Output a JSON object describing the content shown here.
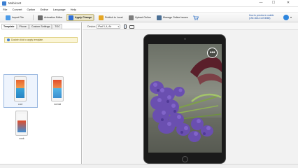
{
  "window": {
    "title": "Mobicont",
    "minimize": "—",
    "maximize": "☐",
    "close": "✕"
  },
  "menu": [
    "File",
    "Convert",
    "Option",
    "Online",
    "Language",
    "Help"
  ],
  "toolbar": {
    "import_label": "Import File",
    "animation_label": "Animation Editor",
    "apply_label": "Apply Change",
    "publish_label": "Publish to Local",
    "upload_label": "Upload Online",
    "manage_label": "Manage Online Issues",
    "preview_note": "How to preview in mobile (192.168.2.147:8080)"
  },
  "tabs": [
    "Template",
    "Phone",
    "Custom Settings",
    "TOC"
  ],
  "left_panel": {
    "info_text": "Double click to apply template.",
    "templates": [
      {
        "label": "cool"
      },
      {
        "label": "normal"
      },
      {
        "label": "cook"
      }
    ]
  },
  "device_bar": {
    "label": "Device:",
    "selected": "iPad 3, 4, Air"
  },
  "preview": {
    "menu_glyph": "●●●"
  },
  "colors": {
    "accent": "#3d7fd1",
    "apply_bg": "#e9e4c8",
    "info_bg": "#fbf5d6",
    "lavender": "#6a4fb0",
    "leaves": "#7ea04a",
    "ribbon": "#5a1f2a"
  },
  "icons": {
    "import": "import-icon",
    "animation": "film-icon",
    "apply": "apply-icon",
    "publish": "publish-icon",
    "upload": "upload-icon",
    "manage": "manage-icon",
    "cart": "cart-icon",
    "user": "user-icon"
  }
}
